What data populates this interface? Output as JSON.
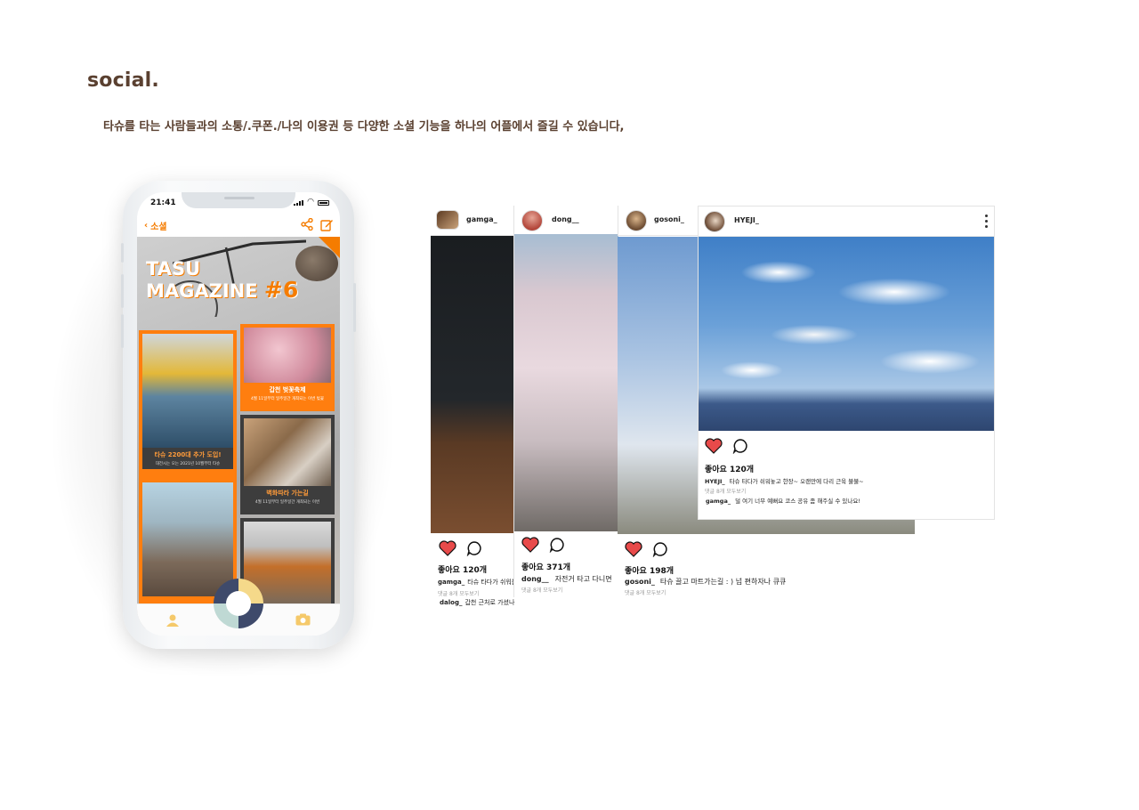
{
  "page": {
    "title": "social.",
    "description": "타슈를 타는 사람들과의 소통/.쿠폰./나의 이용권 등 다양한 소셜 기능을 하나의 어플에서 즐길 수 있습니다,"
  },
  "phone": {
    "status_time": "21:41",
    "header": {
      "back_label": "소셜"
    },
    "magazine": {
      "title_line1": "TASU",
      "title_line2": "MAGAZINE",
      "issue": "#6",
      "cards": [
        {
          "title": "타슈 2200대 추가 도입!",
          "subtitle": "대전시는 오는 2021년 10월부터 타슈"
        },
        {
          "title": "갑천 벚꽃축제",
          "subtitle": "4월 11일부터 일주일간 개최되는 이번 벚꽃"
        },
        {
          "title": "벽화따라 가는길",
          "subtitle": "4월 11일부터 일주일간 개최되는 이번"
        },
        {
          "title": "",
          "subtitle": ""
        }
      ]
    },
    "tabbar": {
      "left_icon": "user-icon",
      "right_icon": "camera-icon"
    }
  },
  "posts": [
    {
      "username": "gamga_",
      "likes": "좋아요  120개",
      "caption_user": "gamga_",
      "caption_text": "타슈 타다가 쉬워볼",
      "view_all": "댓글 8개 모두보기",
      "comment_user": "dalog_",
      "comment_text": "갑천 근처로 가셨나"
    },
    {
      "username": "dong__",
      "likes": "좋아요  371개",
      "caption_user": "dong__",
      "caption_text": "자전거 타고 다니면",
      "view_all": "댓글 8개 모두보기"
    },
    {
      "username": "gosoni_",
      "likes": "좋아요  198개",
      "caption_user": "gosoni_",
      "caption_text": "타슈 끌고 마트가는길 : ) 넘 편하자나 큐큐",
      "view_all": "댓글 8개 모두보기"
    },
    {
      "username": "HYEJI_",
      "likes": "좋아요  120개",
      "caption_user": "HYEJI_",
      "caption_text": "타슈 타다가 쉬워놓고 한장~ 오랜만에 다리 근육 불불~",
      "view_all": "댓글 8개 모두보기",
      "comment_user": "gamga_",
      "comment_text": "덜 여기 너무 예뻐요 코스 공유 좀 해주실 수 있나요!"
    }
  ],
  "colors": {
    "accent": "#f57c00",
    "text_brown": "#5a4030",
    "heart": "#e84a4a"
  }
}
